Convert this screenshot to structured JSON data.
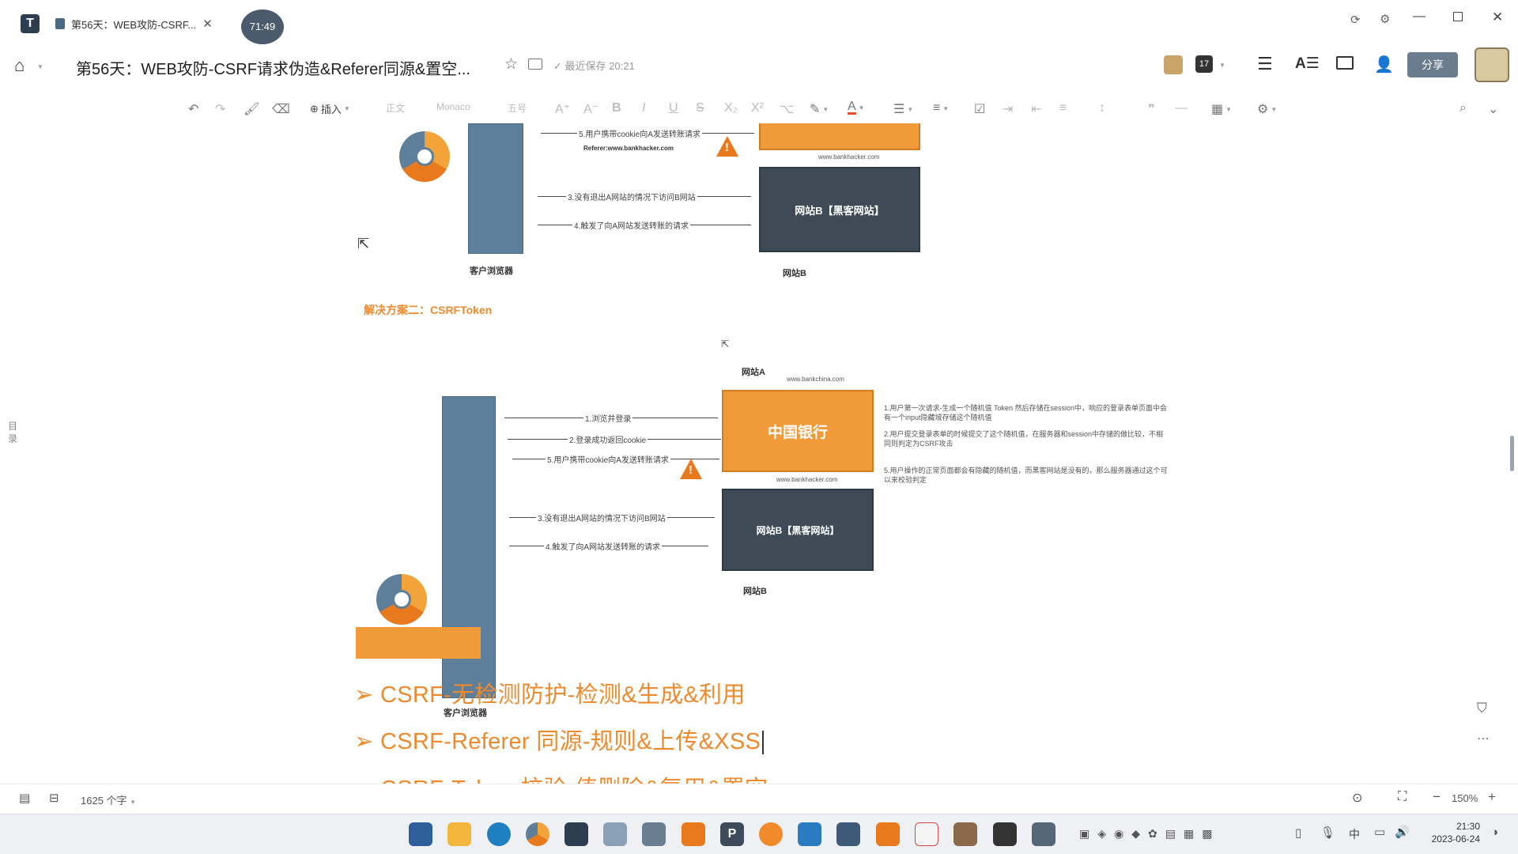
{
  "app": {
    "brand_color": "#2c3e50",
    "accent": "#f19a3a"
  },
  "tab": {
    "title": "第56天：WEB攻防-CSRF...",
    "badge": "71:49"
  },
  "header": {
    "doc_title": "第56天：WEB攻防-CSRF请求伪造&Referer同源&置空...",
    "save_status": "最近保存 20:21",
    "share_label": "分享"
  },
  "toolbar": {
    "insert_label": "插入",
    "style_label": "正文",
    "font_label": "Monaco",
    "size_label": "五号"
  },
  "side": {
    "toc_label": "目录"
  },
  "diagram_top": {
    "arrow5": "5.用户携带cookie向A发送转账请求",
    "referer": "Referer:www.bankhacker.com",
    "domain_b": "www.bankhacker.com",
    "arrow3": "3.没有退出A网站的情况下访问B网站",
    "arrow4": "4.触发了向A网站发送转账的请求",
    "site_b_box": "网站B【黑客网站】",
    "browser_caption": "客户浏览器",
    "site_b_caption": "网站B"
  },
  "solution_label": "解决方案二：CSRFToken",
  "diagram_bottom": {
    "site_a_caption": "网站A",
    "domain_a": "www.bankchina.com",
    "bank_box": "中国银行",
    "arrow1": "1.浏览并登录",
    "arrow2": "2.登录成功返回cookie",
    "arrow5": "5.用户携带cookie向A发送转账请求",
    "domain_b": "www.bankhacker.com",
    "arrow3": "3.没有退出A网站的情况下访问B网站",
    "arrow4": "4.触发了向A网站发送转账的请求",
    "site_b_box": "网站B【黑客网站】",
    "browser_caption": "客户浏览器",
    "site_b_caption": "网站B",
    "note1": "1.用户第一次请求-生成一个随机值 Token 然后存储在session中，响应的登录表单页面中会有一个input隐藏域存储这个随机值",
    "note2": "2.用户提交登录表单的时候提交了这个随机值，在服务器和session中存储的做比较，不相同则判定为CSRF攻击",
    "note5": "5.用户操作的正常页面都会有隐藏的随机值，而黑客网站是没有的，那么服务器通过这个可以来校验判定"
  },
  "headings": [
    "CSRF-无检测防护-检测&生成&利用",
    "CSRF-Referer 同源-规则&上传&XSS",
    "CSRF-Token 校验-值删除&复用&置空"
  ],
  "status": {
    "word_count": "1625 个字",
    "zoom": "150%"
  },
  "taskbar": {
    "time": "21:30",
    "date": "2023-06-24",
    "ime": "中"
  }
}
